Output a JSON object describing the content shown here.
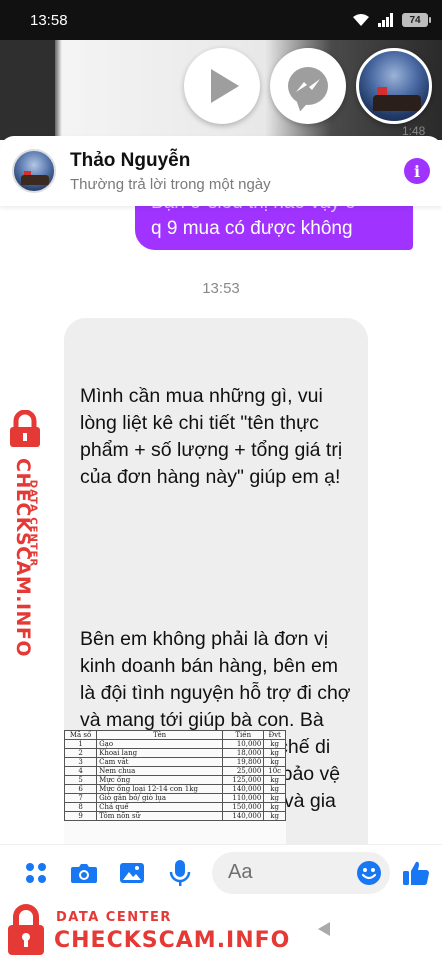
{
  "status_bar": {
    "time": "13:58",
    "battery": "74"
  },
  "video": {
    "time_label": "1:48"
  },
  "header": {
    "name": "Thảo Nguyễn",
    "subtitle": "Thường trả lời trong một ngày"
  },
  "chat": {
    "sent_partial_line1": "Bạn ở siêu thị nào vậy ở",
    "sent_partial_line2": "q 9 mua có được không",
    "timestamp": "13:53",
    "received_para1": "Mình cần mua những gì, vui lòng liệt kê chi tiết \"tên thực phẩm + số lượng + tổng giá trị của đơn hàng này\" giúp em ạ!",
    "received_para2": "Bên em không phải là đơn vị kinh doanh bán hàng, bên em là đội tình nguyện hỗ trợ đi chợ  và mang tới giúp bà con. Bà con ở yên tại chỗ, hạn chế di chuyển có trách nhiệm bảo vệ sức khỏe cho bản thân và gia đình và cộng đồng nhé!"
  },
  "attachment_table": {
    "headers": [
      "Mã số",
      "Tên",
      "Tiền",
      "Đvt"
    ],
    "rows": [
      [
        "1",
        "Gạo",
        "10,000",
        "kg"
      ],
      [
        "2",
        "Khoai lang",
        "18,000",
        "kg"
      ],
      [
        "3",
        "Cam vắt",
        "19,800",
        "kg"
      ],
      [
        "4",
        "Nem chua",
        "25,000",
        "10c"
      ],
      [
        "5",
        "Mực ống",
        "125,000",
        "kg"
      ],
      [
        "6",
        "Mực ống loại 12-14 con 1kg",
        "140,000",
        "kg"
      ],
      [
        "7",
        "Giò gân bó/ giò lụa",
        "110,000",
        "kg"
      ],
      [
        "8",
        "Chả quế",
        "150,000",
        "kg"
      ],
      [
        "9",
        "Tôm nõn sữ",
        "140,000",
        "kg"
      ]
    ]
  },
  "composer": {
    "placeholder": "Aa"
  },
  "watermark": {
    "side_small": "DATA CENTER",
    "side_big": "CHECKSCAM.INFO",
    "bottom_small": "DATA CENTER",
    "bottom_big": "CHECKSCAM.INFO"
  },
  "colors": {
    "accent": "#a033ff",
    "messenger_blue": "#1877f2",
    "watermark_red": "#e53935"
  },
  "icons": [
    "wifi-icon",
    "signal-icon",
    "battery-icon",
    "play-icon",
    "messenger-icon",
    "info-icon",
    "apps-icon",
    "camera-icon",
    "gallery-icon",
    "microphone-icon",
    "emoji-icon",
    "thumbs-up-icon",
    "lock-icon",
    "nav-back-icon"
  ]
}
